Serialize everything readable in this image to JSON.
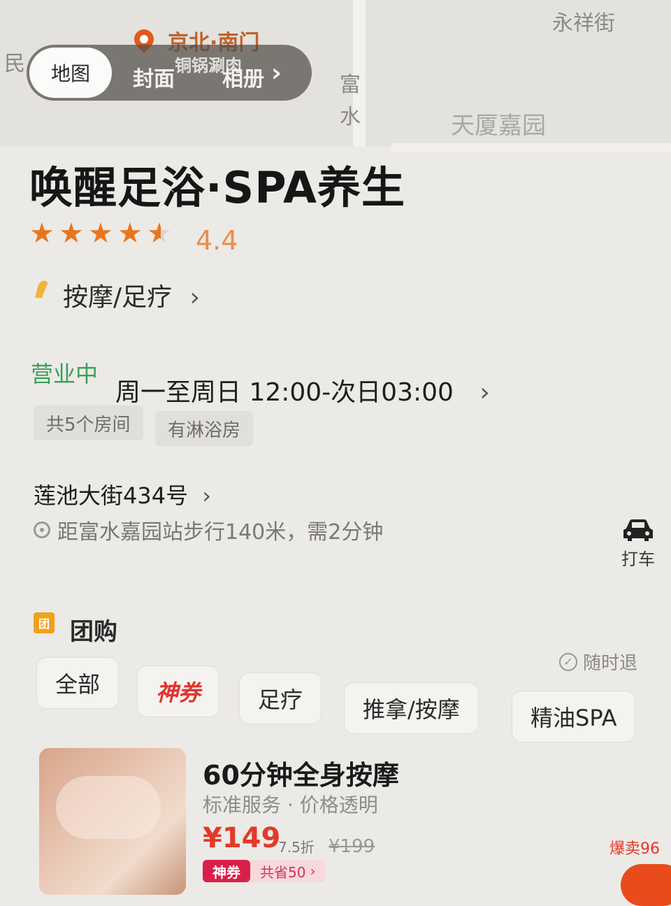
{
  "map": {
    "labels": {
      "min": "民",
      "street": "永祥街",
      "fu": "富",
      "shui": "水",
      "estate": "天厦嘉园"
    },
    "pin_label": "京北·南门",
    "tabs": {
      "map": "地图",
      "photo1": "封面",
      "photo2": "铜锅涮肉",
      "album": "相册",
      "arrow": "›"
    }
  },
  "shop": {
    "name": "唤醒足浴·SPA养生",
    "rating": "4.4",
    "stars": 4.5,
    "category": "按摩/足疗",
    "status": "营业中",
    "hours": "周一至周日 12:00-次日03:00",
    "tags": [
      "共5个房间",
      "有淋浴房"
    ],
    "address": "莲池大街434号",
    "distance": "距富水嘉园站步行140米，需2分钟",
    "taxi": "打车"
  },
  "group": {
    "title": "团购",
    "badge": "团",
    "refund": "随时退",
    "filters": [
      "全部",
      "神券",
      "足疗",
      "推拿/按摩",
      "精油SPA"
    ]
  },
  "deal": {
    "title": "60分钟全身按摩",
    "subtitle": "标准服务 · 价格透明",
    "price": "¥149",
    "discount": "7.5折",
    "original": "¥199",
    "badge": "神券",
    "coupon": "共省50",
    "sold": "爆卖96"
  },
  "colors": {
    "accent": "#e8761f",
    "open": "#3aa056",
    "price": "#e23a2a"
  }
}
